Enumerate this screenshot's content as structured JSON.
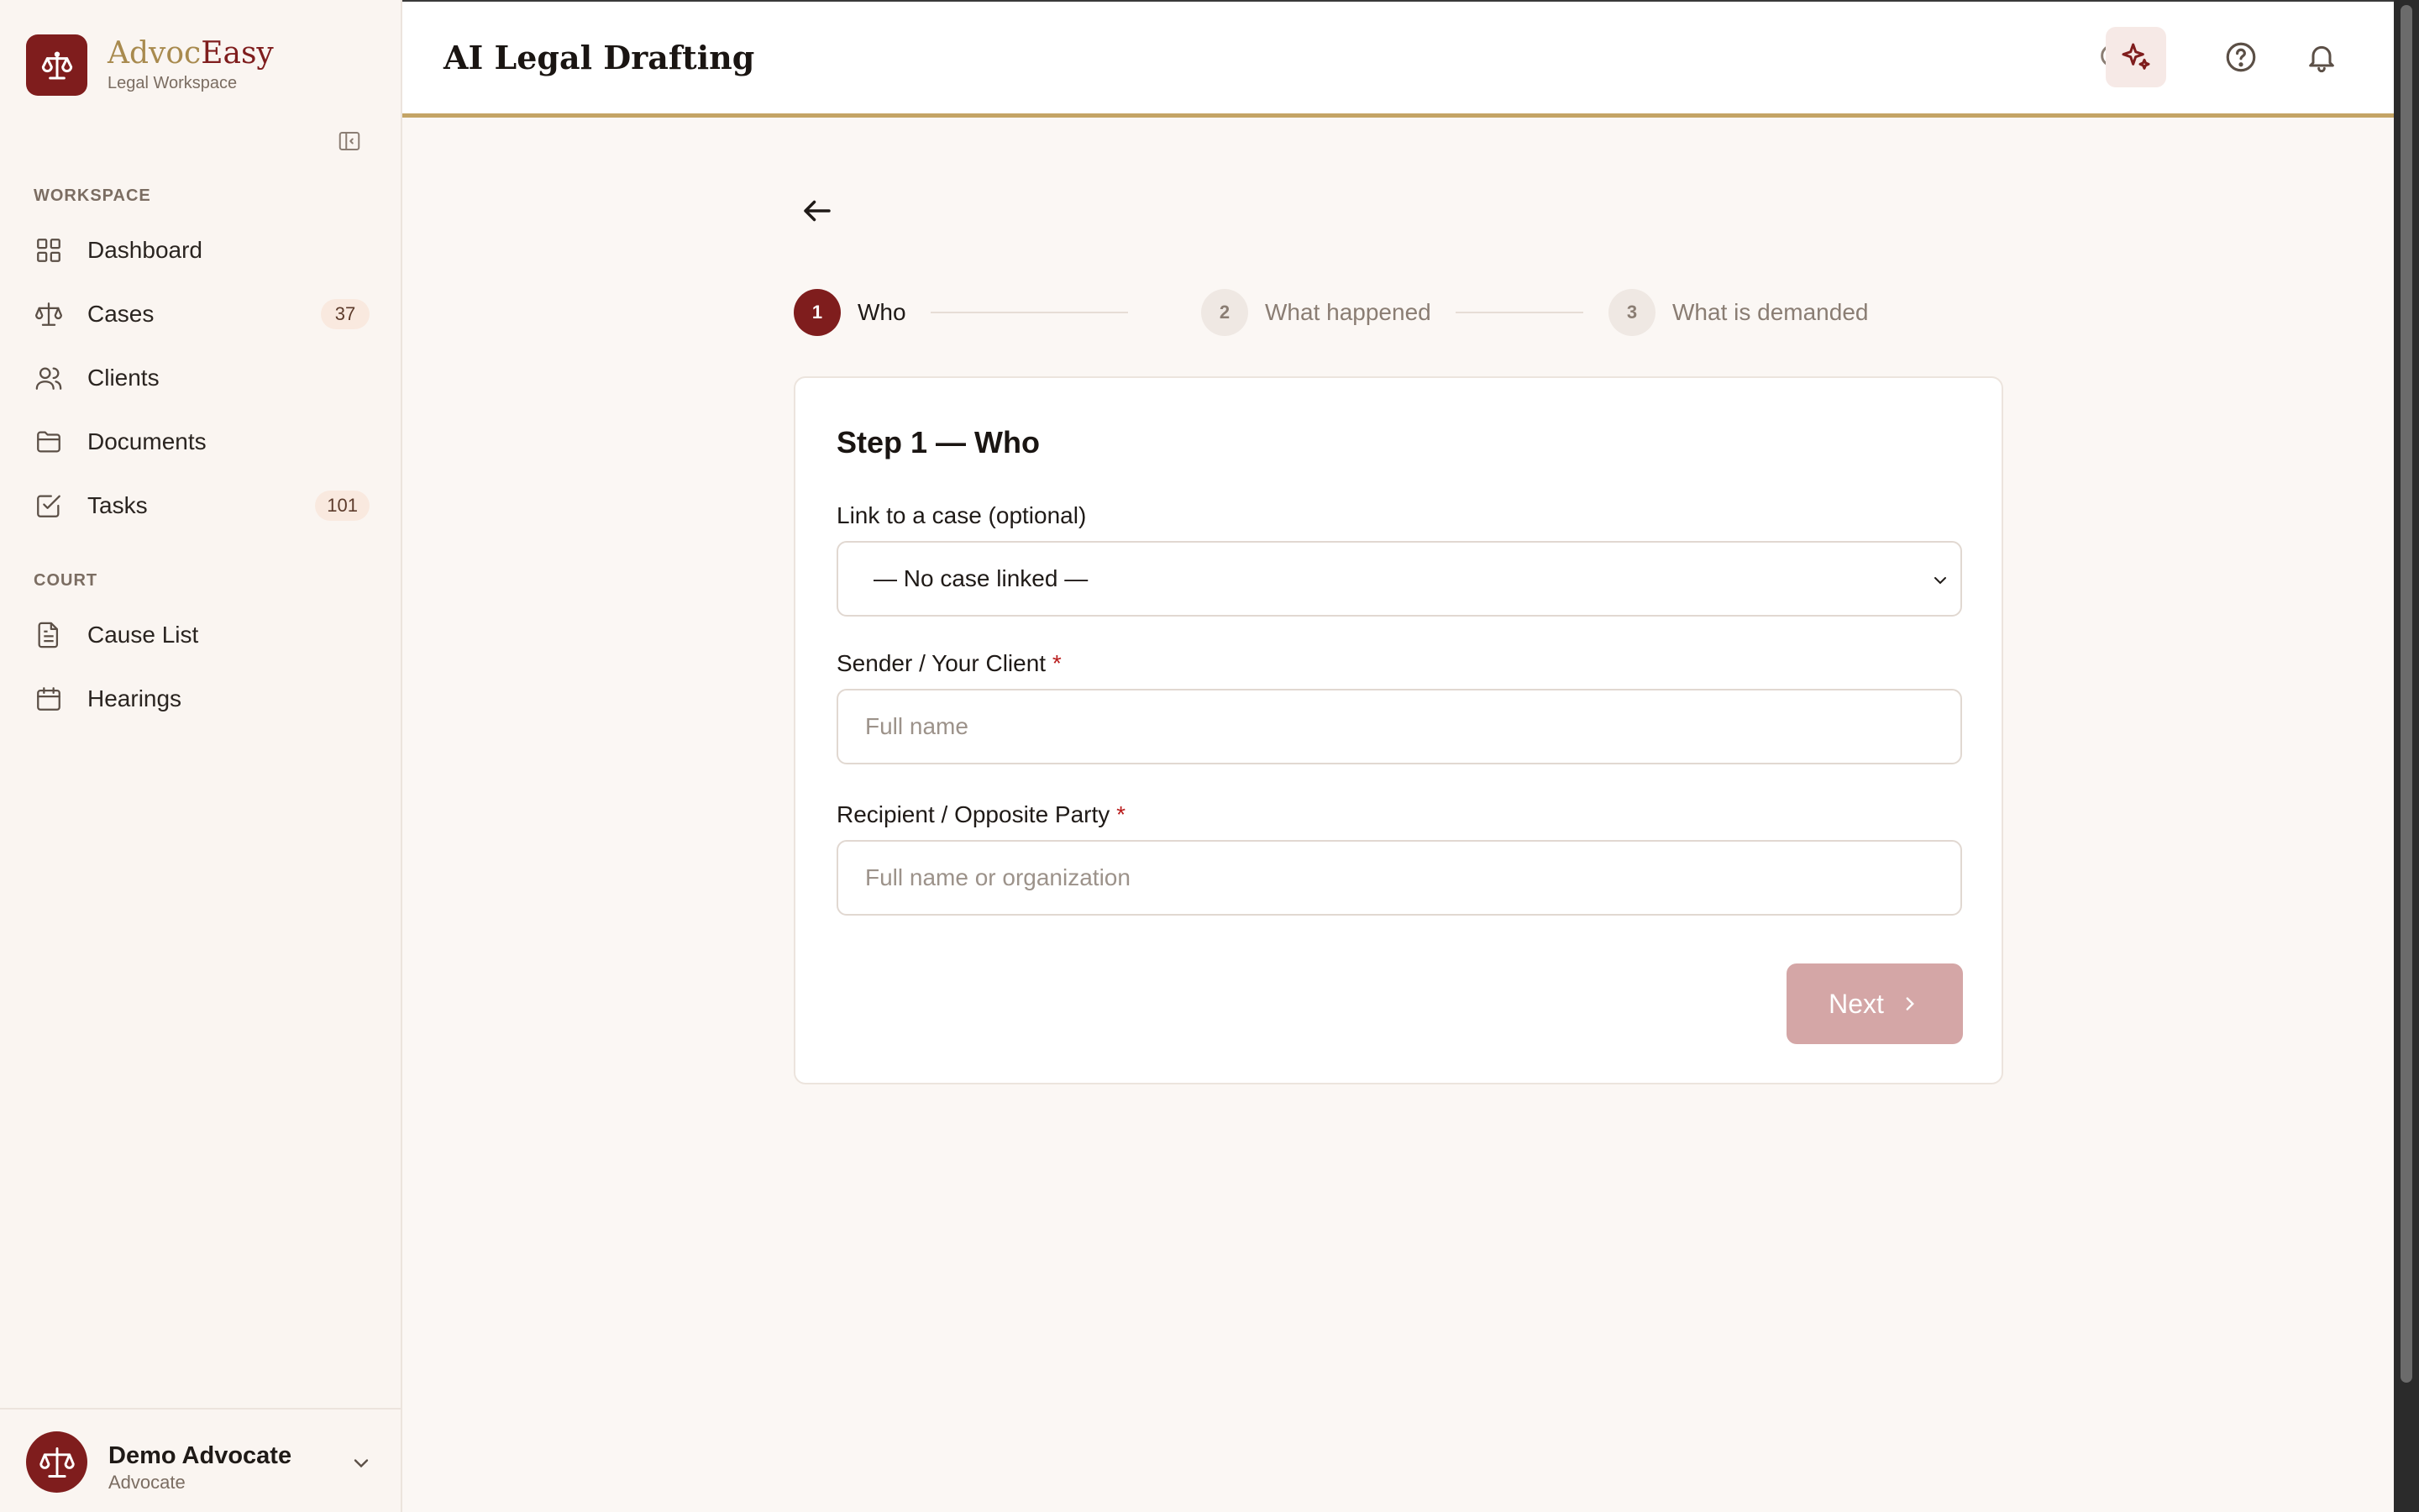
{
  "brand": {
    "name_part1": "Advoc",
    "name_part2": "Easy",
    "subtitle": "Legal Workspace"
  },
  "sidebar": {
    "sections": [
      {
        "label": "WORKSPACE"
      },
      {
        "label": "COURT"
      }
    ],
    "items": [
      {
        "label": "Dashboard",
        "icon": "grid-icon"
      },
      {
        "label": "Cases",
        "icon": "scales-icon",
        "badge": "37"
      },
      {
        "label": "Clients",
        "icon": "users-icon"
      },
      {
        "label": "Documents",
        "icon": "folder-icon"
      },
      {
        "label": "Tasks",
        "icon": "checkbox-icon",
        "badge": "101"
      },
      {
        "label": "Cause List",
        "icon": "document-icon"
      },
      {
        "label": "Hearings",
        "icon": "calendar-icon"
      }
    ],
    "user": {
      "name": "Demo Advocate",
      "role": "Advocate"
    }
  },
  "header": {
    "title": "AI Legal Drafting"
  },
  "stepper": {
    "steps": [
      {
        "number": "1",
        "label": "Who",
        "state": "active"
      },
      {
        "number": "2",
        "label": "What happened",
        "state": "inactive"
      },
      {
        "number": "3",
        "label": "What is demanded",
        "state": "inactive"
      }
    ]
  },
  "form": {
    "title": "Step 1 — Who",
    "case_label": "Link to a case (optional)",
    "case_value": "— No case linked —",
    "sender_label": "Sender / Your Client",
    "sender_placeholder": "Full name",
    "recipient_label": "Recipient / Opposite Party",
    "recipient_placeholder": "Full name or organization",
    "required_mark": "*",
    "next_label": "Next"
  },
  "colors": {
    "accent": "#7f1d1d",
    "gold": "#c4a465",
    "disabled_button": "#d4a6a6"
  }
}
